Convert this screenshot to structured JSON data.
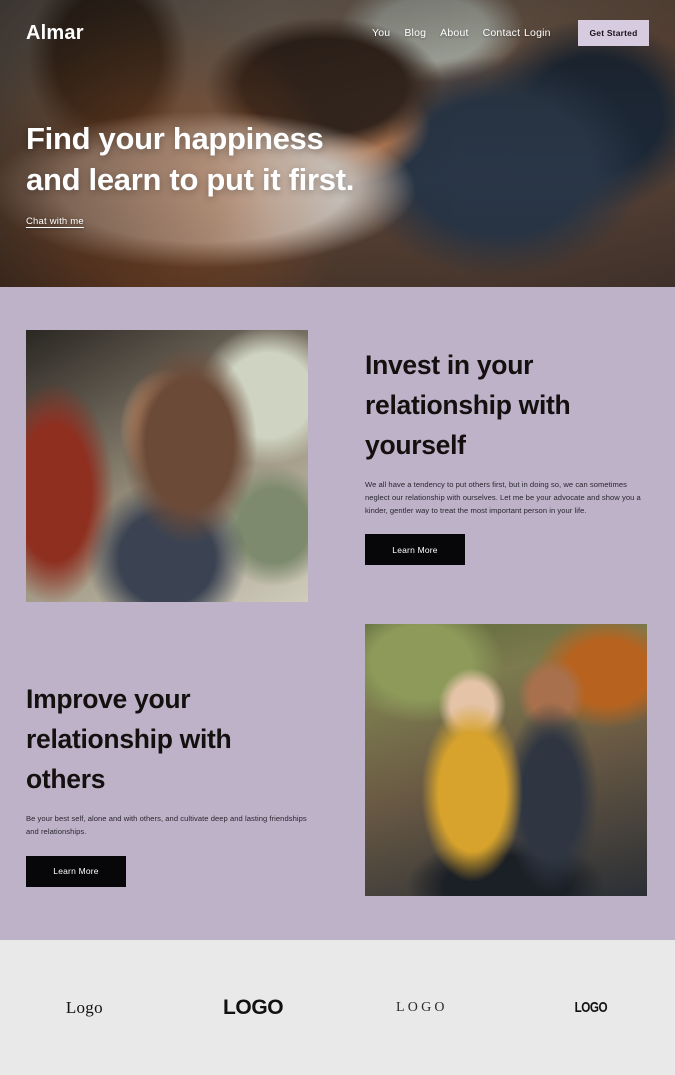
{
  "brand": {
    "name": "Almar"
  },
  "nav": {
    "links": [
      {
        "label": "You"
      },
      {
        "label": "Blog"
      },
      {
        "label": "About"
      },
      {
        "label": "Contact"
      }
    ],
    "login_label": "Login",
    "cta_label": "Get Started",
    "cta_color": "#d7cbe0"
  },
  "hero": {
    "title": "Find your happiness\nand learn to put it first.",
    "link_label": "Chat with me",
    "text_color": "#ffffff"
  },
  "main": {
    "background_color": "#bdb2c8",
    "blocks": [
      {
        "title": "Invest in your\nrelationship with\nyourself",
        "body": "We all have a tendency to put others first, but in doing so, we can sometimes neglect our relationship with ourselves. Let me be your advocate and show you a kinder, gentler way to treat the most important person in your life.",
        "button_label": "Learn More"
      },
      {
        "title": "Improve your\nrelationship with\nothers",
        "body": "Be your best self, alone and with others, and cultivate deep and lasting friendships and relationships.",
        "button_label": "Learn More"
      }
    ]
  },
  "footer": {
    "background_color": "#e9e9e9",
    "logos": [
      {
        "label": "Logo"
      },
      {
        "label": "LOGO"
      },
      {
        "label": "LOGO"
      },
      {
        "label": "LOGO"
      }
    ]
  }
}
